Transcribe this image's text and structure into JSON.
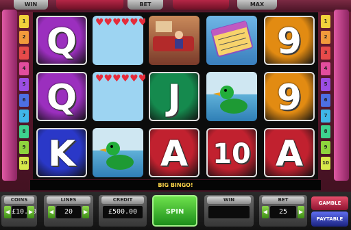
{
  "top_tabs": [
    "WIN",
    "BET",
    "MAX"
  ],
  "paylines_left": [
    "1",
    "2",
    "3",
    "4",
    "5",
    "6",
    "7",
    "8",
    "9",
    "10"
  ],
  "paylines_right": [
    "1",
    "2",
    "3",
    "4",
    "5",
    "6",
    "7",
    "8",
    "9",
    "10"
  ],
  "reels": [
    [
      {
        "symbol": "Q",
        "type": "letter",
        "color": "#9b2fbe"
      },
      {
        "symbol": "Q",
        "type": "letter",
        "color": "#9b2fbe"
      },
      {
        "symbol": "K",
        "type": "letter",
        "color": "#2a38c8"
      }
    ],
    [
      {
        "symbol": "hearts-card",
        "type": "hearts"
      },
      {
        "symbol": "hearts-card",
        "type": "hearts"
      },
      {
        "symbol": "duck",
        "type": "duck"
      }
    ],
    [
      {
        "symbol": "bingo-hall",
        "type": "scene"
      },
      {
        "symbol": "J",
        "type": "letter",
        "color": "#158a4e"
      },
      {
        "symbol": "A",
        "type": "letter",
        "color": "#c1212f"
      }
    ],
    [
      {
        "symbol": "bingo-card",
        "type": "card"
      },
      {
        "symbol": "duck",
        "type": "duck"
      },
      {
        "symbol": "10",
        "type": "letter",
        "color": "#c1212f"
      }
    ],
    [
      {
        "symbol": "9",
        "type": "letter",
        "color": "#e28b12"
      },
      {
        "symbol": "9",
        "type": "letter",
        "color": "#e28b12"
      },
      {
        "symbol": "A",
        "type": "letter",
        "color": "#c1212f"
      }
    ]
  ],
  "message": "BIG BINGO!",
  "panels": [
    {
      "label": "COINS",
      "value": "£10.00"
    },
    {
      "label": "LINES",
      "value": "20"
    },
    {
      "label": "CREDIT",
      "value": "£500.00"
    },
    {
      "label": "WIN",
      "value": ""
    },
    {
      "label": "BET",
      "value": "25"
    }
  ],
  "spin_label": "SPIN",
  "paytable_label": "PAYTABLE",
  "gamble_label": "GAMBLE"
}
